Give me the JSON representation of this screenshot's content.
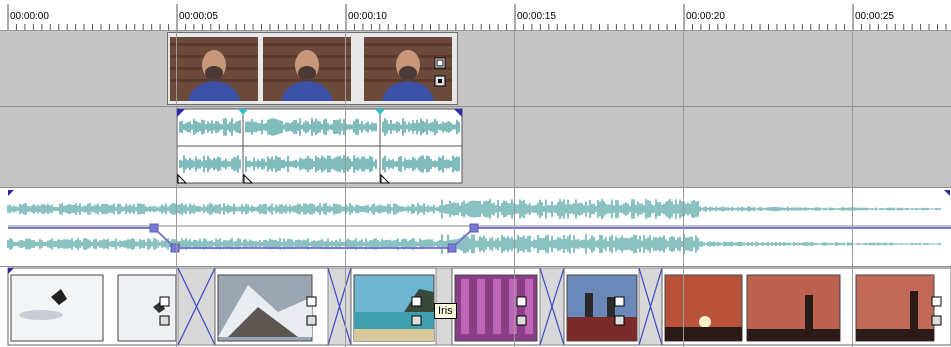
{
  "ruler": {
    "labels": [
      "00:00:00",
      "00:00:05",
      "00:00:10",
      "00:00:15",
      "00:00:20",
      "00:00:25"
    ]
  },
  "tracks": [
    {
      "name": "video-overlay-track",
      "clips": [
        {
          "name": "presenter-clip",
          "thumbnails": 3
        }
      ]
    },
    {
      "name": "audio-voice-track",
      "clips": [
        {
          "name": "voice-audio-clip-1"
        },
        {
          "name": "voice-audio-clip-2"
        },
        {
          "name": "voice-audio-clip-3"
        }
      ]
    },
    {
      "name": "music-audio-track",
      "clips": [
        {
          "name": "music-audio-clip"
        }
      ]
    },
    {
      "name": "main-video-track",
      "clips": [
        {
          "name": "snowboard-clip-1"
        },
        {
          "name": "snowboard-clip-2"
        },
        {
          "name": "mountain-clip"
        },
        {
          "name": "beach-clip"
        },
        {
          "name": "flowers-clip"
        },
        {
          "name": "boat-clip"
        },
        {
          "name": "sunset-clip-1"
        },
        {
          "name": "sunset-clip-2"
        },
        {
          "name": "sunset-clip-3"
        }
      ]
    }
  ],
  "tooltip": {
    "text": "Iris"
  },
  "colors": {
    "waveform": "#4aa0a0",
    "envelope": "#7a7ad6",
    "transition": "#3a46c8",
    "marker": "#2828b0",
    "marker_cyan": "#29c3c9"
  }
}
